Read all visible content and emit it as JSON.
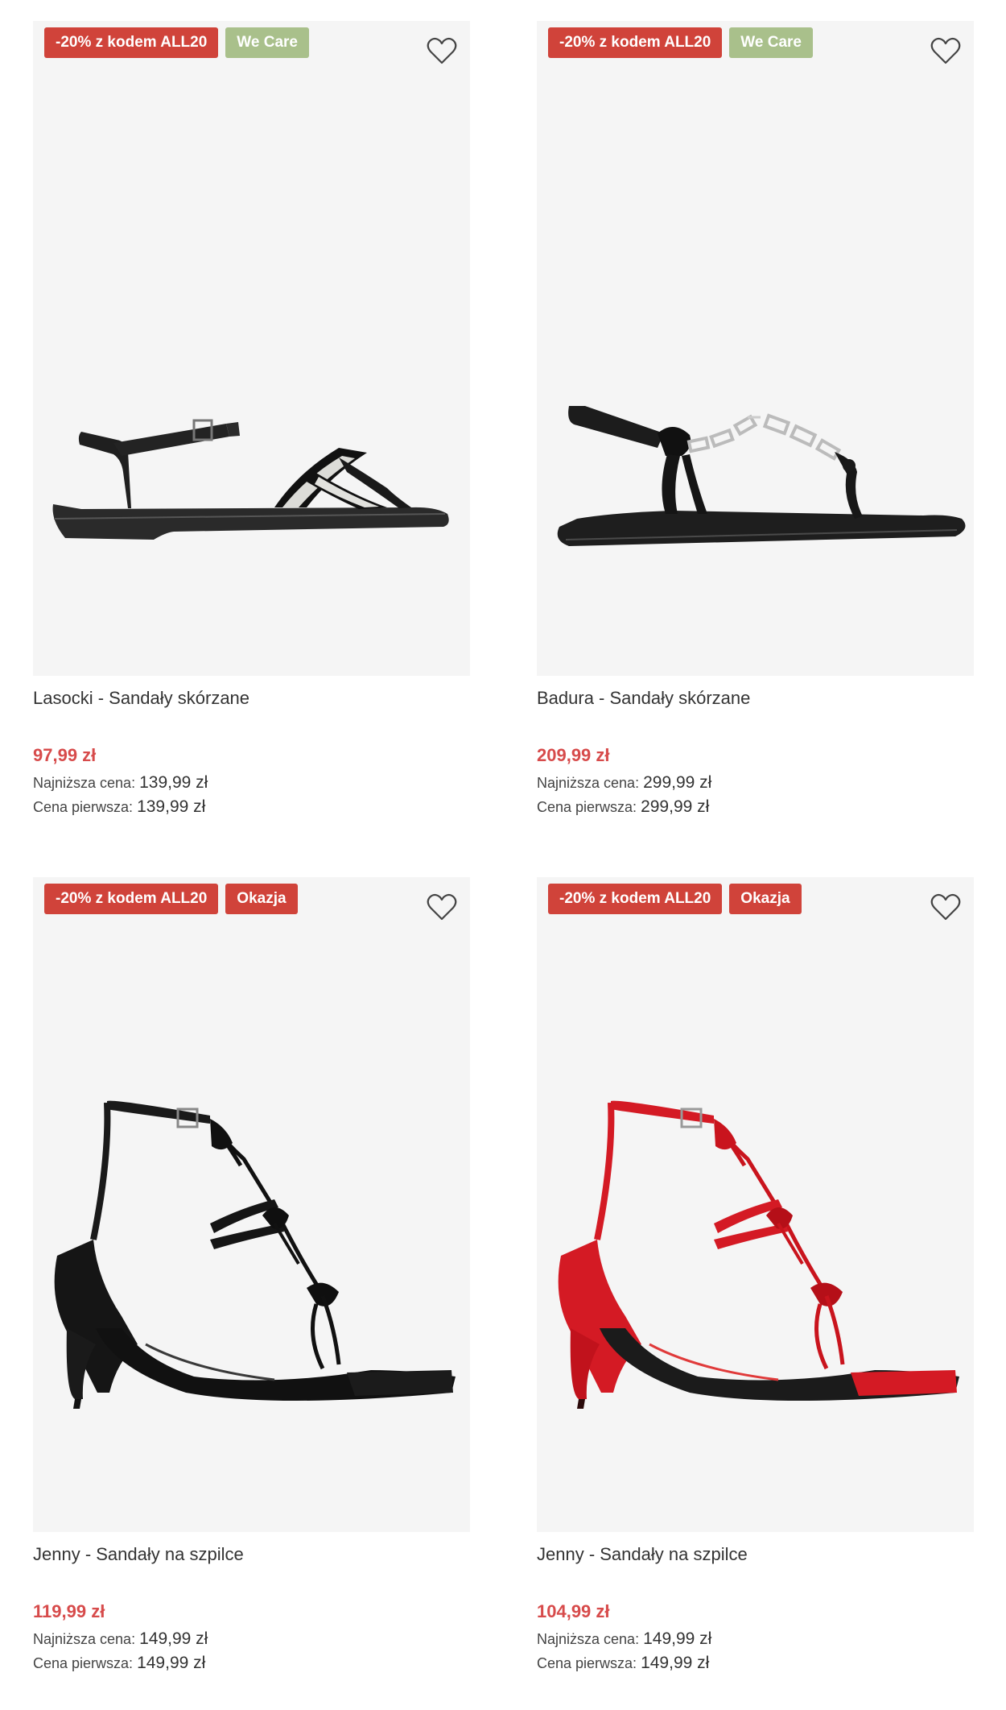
{
  "colors": {
    "promo_badge": "#d0433a",
    "we_care_badge": "#a9c08b",
    "okazja_badge": "#d0433a",
    "price": "#d74b4b",
    "image_bg": "#f5f5f5"
  },
  "products": [
    {
      "badges": [
        {
          "label": "-20% z kodem ALL20",
          "type": "promo"
        },
        {
          "label": "We Care",
          "type": "we-care"
        }
      ],
      "name": "Lasocki - Sandały skórzane",
      "price": "97,99 zł",
      "lowest_label": "Najniższa cena:",
      "lowest_value": "139,99 zł",
      "first_label": "Cena pierwsza:",
      "first_value": "139,99 zł",
      "image": "black-white-flat-sandal",
      "wishlist_icon": "heart-icon"
    },
    {
      "badges": [
        {
          "label": "-20% z kodem ALL20",
          "type": "promo"
        },
        {
          "label": "We Care",
          "type": "we-care"
        }
      ],
      "name": "Badura - Sandały skórzane",
      "price": "209,99 zł",
      "lowest_label": "Najniższa cena:",
      "lowest_value": "299,99 zł",
      "first_label": "Cena pierwsza:",
      "first_value": "299,99 zł",
      "image": "black-jewel-thong-sandal",
      "wishlist_icon": "heart-icon"
    },
    {
      "badges": [
        {
          "label": "-20% z kodem ALL20",
          "type": "promo"
        },
        {
          "label": "Okazja",
          "type": "okazja"
        }
      ],
      "name": "Jenny - Sandały na szpilce",
      "price": "119,99 zł",
      "lowest_label": "Najniższa cena:",
      "lowest_value": "149,99 zł",
      "first_label": "Cena pierwsza:",
      "first_value": "149,99 zł",
      "image": "black-stiletto-sandal",
      "wishlist_icon": "heart-icon"
    },
    {
      "badges": [
        {
          "label": "-20% z kodem ALL20",
          "type": "promo"
        },
        {
          "label": "Okazja",
          "type": "okazja"
        }
      ],
      "name": "Jenny - Sandały na szpilce",
      "price": "104,99 zł",
      "lowest_label": "Najniższa cena:",
      "lowest_value": "149,99 zł",
      "first_label": "Cena pierwsza:",
      "first_value": "149,99 zł",
      "image": "red-stiletto-sandal",
      "wishlist_icon": "heart-icon"
    }
  ]
}
